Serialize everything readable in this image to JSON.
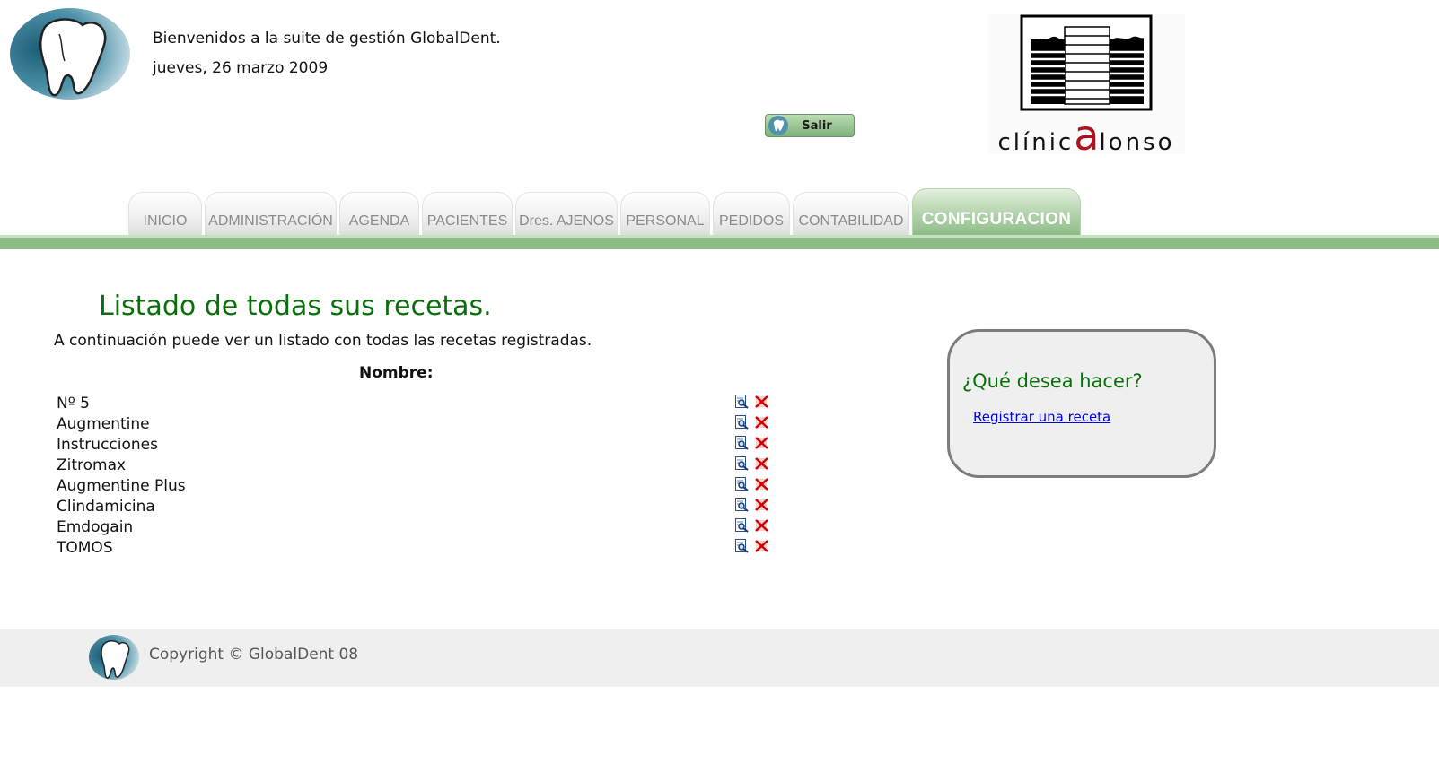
{
  "header": {
    "welcome": "Bienvenidos a la suite de gestión GlobalDent.",
    "date": "jueves, 26 marzo 2009",
    "logout_label": "Salir",
    "clinic_logo": {
      "prefix": "clínic",
      "highlight": "a",
      "suffix": "lonso",
      "highlight_color": "#b01020"
    }
  },
  "nav": {
    "tabs": [
      {
        "label": "INICIO"
      },
      {
        "label": "ADMINISTRACIÓN"
      },
      {
        "label": "AGENDA"
      },
      {
        "label": "PACIENTES"
      },
      {
        "label": "Dres. AJENOS"
      },
      {
        "label": "PERSONAL"
      },
      {
        "label": "PEDIDOS"
      },
      {
        "label": "CONTABILIDAD"
      },
      {
        "label": "CONFIGURACION",
        "active": true
      }
    ],
    "accent_color": "#8cbd87"
  },
  "main": {
    "title": "Listado de todas sus recetas.",
    "intro": "A continuación puede ver un listado con todas las recetas registradas.",
    "column_header": "Nombre:",
    "recipes": [
      {
        "name": "Nº 5"
      },
      {
        "name": "Augmentine"
      },
      {
        "name": "Instrucciones"
      },
      {
        "name": "Zitromax"
      },
      {
        "name": "Augmentine Plus"
      },
      {
        "name": "Clindamicina"
      },
      {
        "name": "Emdogain"
      },
      {
        "name": "TOMOS"
      }
    ],
    "row_icons": [
      "view-icon",
      "delete-icon"
    ]
  },
  "side_box": {
    "title": "¿Qué desea hacer?",
    "link": "Registrar una receta"
  },
  "footer": {
    "copyright": "Copyright © GlobalDent 08"
  },
  "colors": {
    "title_green": "#0a6e0a",
    "link_blue": "#0000ee"
  }
}
